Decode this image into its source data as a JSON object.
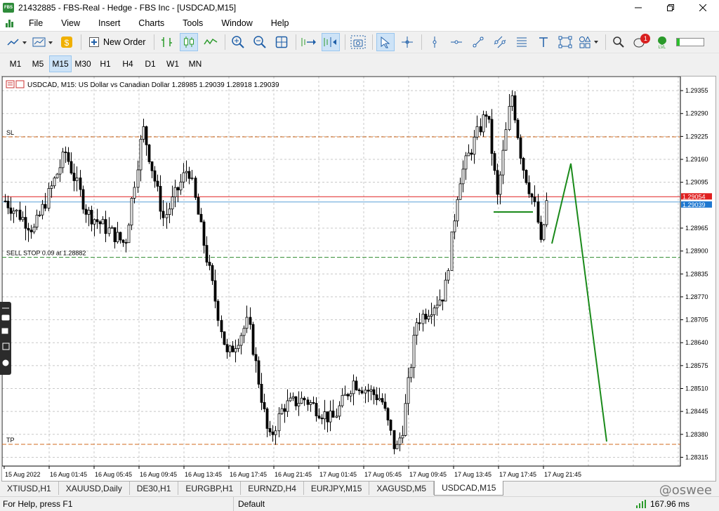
{
  "window": {
    "title": "21432885 - FBS-Real - Hedge - FBS Inc - [USDCAD,M15]",
    "app_icon_text": "FBS"
  },
  "menu": [
    "File",
    "View",
    "Insert",
    "Charts",
    "Tools",
    "Window",
    "Help"
  ],
  "toolbar": {
    "new_order_label": "New Order",
    "notification_count": "1"
  },
  "timeframes": [
    "M1",
    "M5",
    "M15",
    "M30",
    "H1",
    "H4",
    "D1",
    "W1",
    "MN"
  ],
  "active_timeframe": "M15",
  "chart": {
    "header": "USDCAD, M15:  US Dollar vs Canadian Dollar  1.28985 1.29039 1.28918 1.29039",
    "sl_label": "SL",
    "tp_label": "TP",
    "sell_stop_label": "SELL STOP 0.09 at 1.28882",
    "current_price_label": "1.29039",
    "bid_line_label": "1.29054",
    "price_ticks": [
      "1.29355",
      "1.29290",
      "1.29225",
      "1.29160",
      "1.29095",
      "1.28965",
      "1.28900",
      "1.28835",
      "1.28770",
      "1.28705",
      "1.28640",
      "1.28575",
      "1.28510",
      "1.28445",
      "1.28380",
      "1.28315"
    ],
    "time_ticks": [
      "15 Aug 2022",
      "16 Aug 01:45",
      "16 Aug 05:45",
      "16 Aug 09:45",
      "16 Aug 13:45",
      "16 Aug 17:45",
      "16 Aug 21:45",
      "17 Aug 01:45",
      "17 Aug 05:45",
      "17 Aug 09:45",
      "17 Aug 13:45",
      "17 Aug 17:45",
      "17 Aug 21:45"
    ],
    "colors": {
      "sl_line": "#d2691e",
      "tp_line": "#d2691e",
      "sell_stop_line": "#2e8b2e",
      "bid_line": "#e02020",
      "ask_line": "#5aa0d8",
      "drawing": "#1a8a1a"
    }
  },
  "tabs": [
    "XTIUSD,H1",
    "XAUUSD,Daily",
    "DE30,H1",
    "EURGBP,H1",
    "EURNZD,H4",
    "EURJPY,M15",
    "XAGUSD,M5",
    "USDCAD,M15"
  ],
  "active_tab": "USDCAD,M15",
  "watermark": "@oswee",
  "status": {
    "help": "For Help, press F1",
    "profile": "Default",
    "ping": "167.96 ms"
  }
}
